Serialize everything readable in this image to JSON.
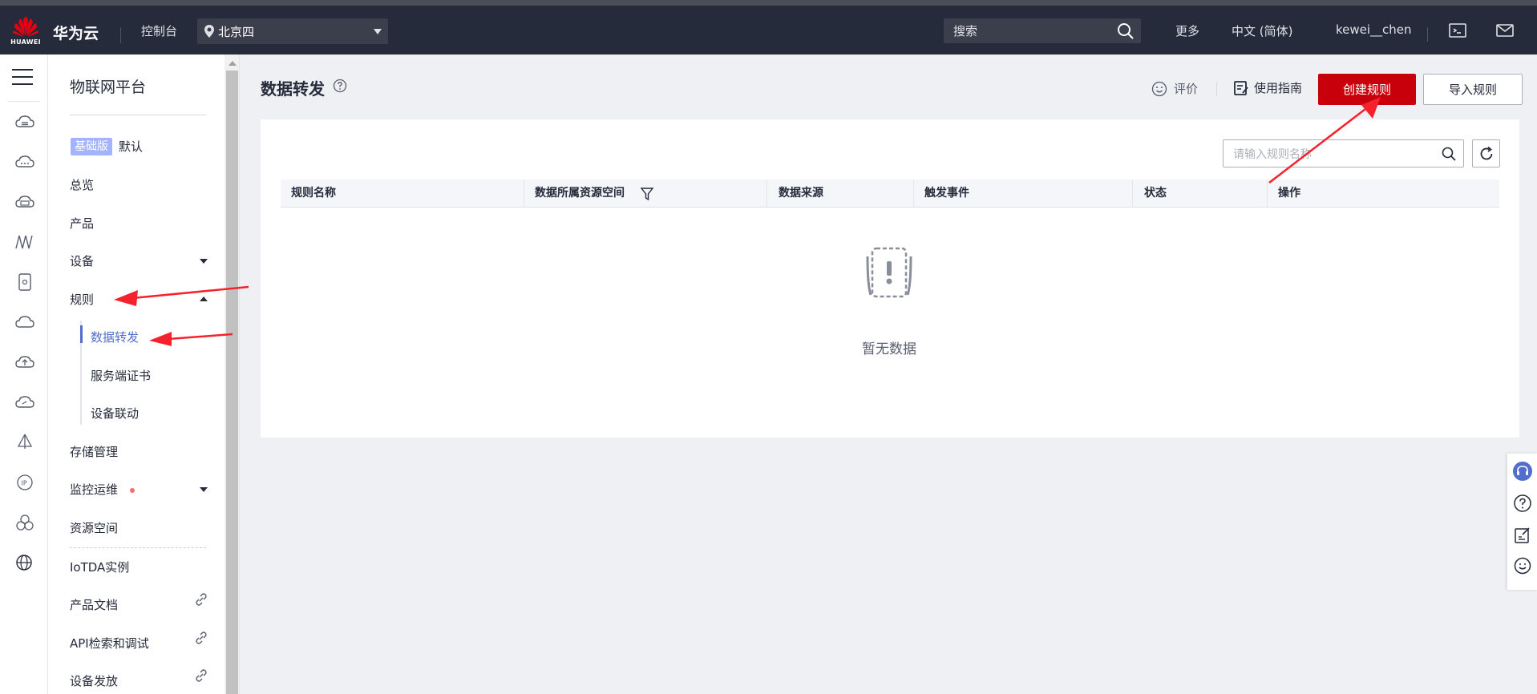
{
  "header": {
    "logo_text": "HUAWEI",
    "brand": "华为云",
    "console": "控制台",
    "region": "北京四",
    "search_placeholder": "搜索",
    "more": "更多",
    "language": "中文 (简体)",
    "username": "kewei__chen"
  },
  "nav": {
    "title": "物联网平台",
    "edition_badge": "基础版",
    "edition_default": "默认",
    "items": [
      {
        "label": "总览"
      },
      {
        "label": "产品"
      },
      {
        "label": "设备"
      },
      {
        "label": "规则"
      },
      {
        "label": "存储管理"
      },
      {
        "label": "监控运维"
      },
      {
        "label": "资源空间"
      },
      {
        "label": "IoTDA实例"
      },
      {
        "label": "产品文档"
      },
      {
        "label": "API检索和调试"
      },
      {
        "label": "设备发放"
      }
    ],
    "rule_subitems": [
      {
        "label": "数据转发",
        "active": true
      },
      {
        "label": "服务端证书"
      },
      {
        "label": "设备联动"
      }
    ]
  },
  "main": {
    "page_title": "数据转发",
    "rate": "评价",
    "guide": "使用指南",
    "create_button": "创建规则",
    "import_button": "导入规则",
    "rule_search_placeholder": "请输入规则名称",
    "table": {
      "columns": [
        "规则名称",
        "数据所属资源空间",
        "数据来源",
        "触发事件",
        "状态",
        "操作"
      ],
      "rows": []
    },
    "empty_text": "暂无数据"
  },
  "colors": {
    "header_bg": "#252b3a",
    "primary_red": "#c7000b",
    "active_blue": "#526ecc",
    "badge_blue": "#a3b3ff",
    "annotation_red": "#f5222d"
  }
}
